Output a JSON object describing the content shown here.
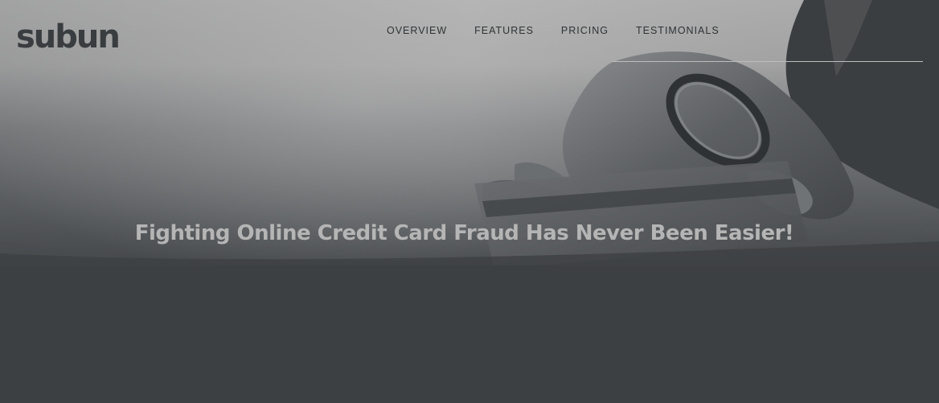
{
  "brand": {
    "logo_text": "subun"
  },
  "nav": {
    "items": [
      {
        "label": "OVERVIEW"
      },
      {
        "label": "FEATURES"
      },
      {
        "label": "PRICING"
      },
      {
        "label": "TESTIMONIALS"
      }
    ]
  },
  "hero": {
    "headline": "Fighting Online Credit Card Fraud Has Never Been Easier!",
    "image": "hand-holding-credit-card-photo"
  },
  "colors": {
    "background": "#3d4043",
    "header_band": "#b3b3b3",
    "headline_text": "#b5b5b5",
    "logo_text": "#3a3d40"
  }
}
